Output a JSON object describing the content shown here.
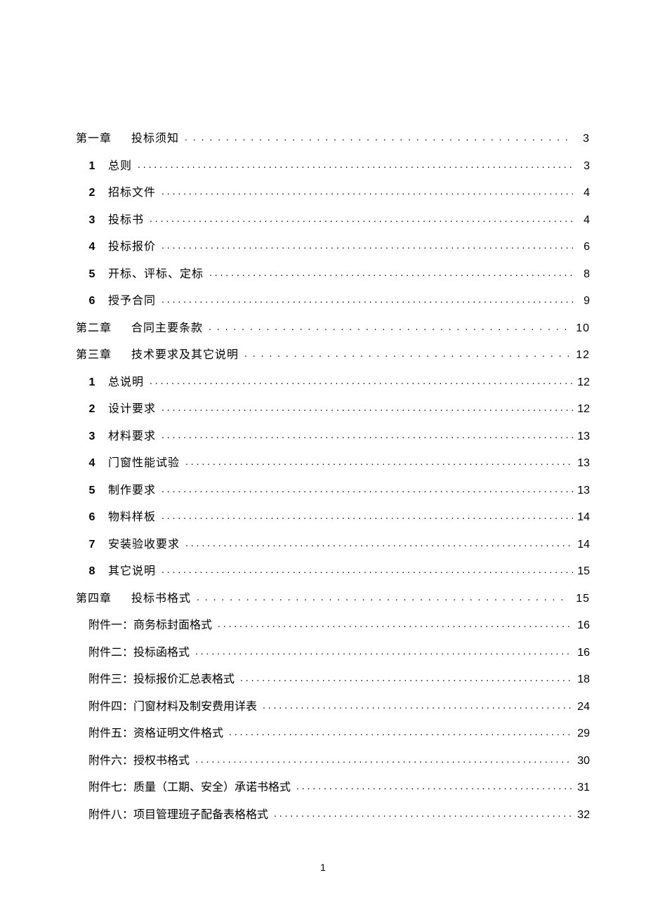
{
  "page_number": "1",
  "toc": [
    {
      "kind": "chapter",
      "chap": "第一章",
      "title": "投标须知",
      "page": "3"
    },
    {
      "kind": "l1",
      "num": "1",
      "title": "总则",
      "page": "3"
    },
    {
      "kind": "l1",
      "num": "2",
      "title": "招标文件",
      "page": "4"
    },
    {
      "kind": "l1",
      "num": "3",
      "title": "投标书",
      "page": "4"
    },
    {
      "kind": "l1",
      "num": "4",
      "title": "投标报价",
      "page": "6"
    },
    {
      "kind": "l1",
      "num": "5",
      "title": "开标、评标、定标",
      "page": "8"
    },
    {
      "kind": "l1",
      "num": "6",
      "title": "授予合同",
      "page": "9"
    },
    {
      "kind": "chapter",
      "chap": "第二章",
      "title": "合同主要条款",
      "page": "10"
    },
    {
      "kind": "chapter",
      "chap": "第三章",
      "title": "技术要求及其它说明",
      "page": "12"
    },
    {
      "kind": "l1",
      "num": "1",
      "title": "总说明",
      "page": "12"
    },
    {
      "kind": "l1",
      "num": "2",
      "title": "设计要求",
      "page": "12"
    },
    {
      "kind": "l1",
      "num": "3",
      "title": "材料要求",
      "page": "13"
    },
    {
      "kind": "l1",
      "num": "4",
      "title": "门窗性能试验",
      "page": "13"
    },
    {
      "kind": "l1",
      "num": "5",
      "title": "制作要求",
      "page": "13"
    },
    {
      "kind": "l1",
      "num": "6",
      "title": "物料样板",
      "page": "14"
    },
    {
      "kind": "l1",
      "num": "7",
      "title": "安装验收要求",
      "page": "14"
    },
    {
      "kind": "l1",
      "num": "8",
      "title": "其它说明",
      "page": "15"
    },
    {
      "kind": "chapter",
      "chap": "第四章",
      "title": "投标书格式",
      "page": "15"
    },
    {
      "kind": "attach",
      "title": "附件一：商务标封面格式",
      "page": "16"
    },
    {
      "kind": "attach",
      "title": "附件二：投标函格式",
      "page": "16"
    },
    {
      "kind": "attach",
      "title": "附件三：投标报价汇总表格式",
      "page": "18"
    },
    {
      "kind": "attach",
      "title": "附件四：门窗材料及制安费用详表",
      "page": "24"
    },
    {
      "kind": "attach",
      "title": "附件五：资格证明文件格式",
      "page": "29"
    },
    {
      "kind": "attach",
      "title": "附件六：授权书格式",
      "page": "30"
    },
    {
      "kind": "attach",
      "title": "附件七：质量（工期、安全）承诺书格式",
      "page": "31"
    },
    {
      "kind": "attach",
      "title": "附件八：项目管理班子配备表格格式",
      "page": "32"
    }
  ]
}
